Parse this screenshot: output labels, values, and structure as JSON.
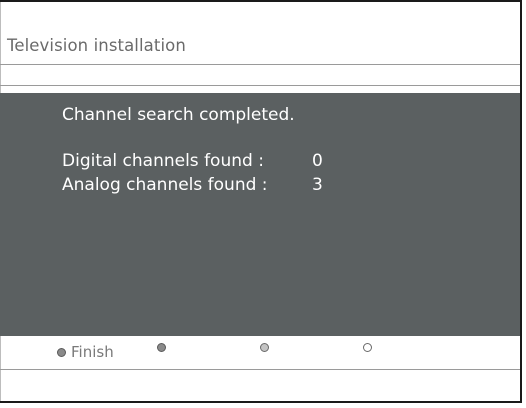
{
  "header": {
    "title": "Television installation"
  },
  "panel": {
    "message": "Channel search completed.",
    "results": [
      {
        "label": "Digital channels found :",
        "value": "0"
      },
      {
        "label": "Analog channels found :",
        "value": "3"
      }
    ]
  },
  "keys": [
    {
      "label": "Finish",
      "color": "#8a8a8a"
    },
    {
      "label": "",
      "color": "#8a8a8a"
    },
    {
      "label": "",
      "color": "#c4c4c4"
    },
    {
      "label": "",
      "color": "#ffffff"
    }
  ],
  "colors": {
    "panel_background": "#5b6061",
    "panel_text": "#ffffff",
    "title_text": "#6a6a6a"
  }
}
